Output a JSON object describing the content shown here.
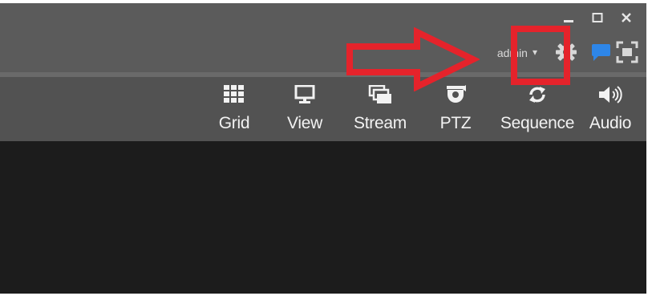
{
  "window": {
    "controls": [
      "minimize",
      "maximize",
      "close"
    ]
  },
  "user": {
    "name": "admin",
    "caret": "▾"
  },
  "header_icons": [
    "gear-icon",
    "chat-icon",
    "fullscreen-icon"
  ],
  "toolbar": {
    "items": [
      {
        "label": "Grid",
        "icon": "grid-icon"
      },
      {
        "label": "View",
        "icon": "monitor-icon"
      },
      {
        "label": "Stream",
        "icon": "stream-icon"
      },
      {
        "label": "PTZ",
        "icon": "ptz-camera-icon"
      },
      {
        "label": "Sequence",
        "icon": "sequence-icon"
      },
      {
        "label": "Audio",
        "icon": "speaker-icon"
      }
    ]
  },
  "colors": {
    "titlebar": "#5b5b5b",
    "toolbar": "#525252",
    "content": "#1c1c1c",
    "annotation": "#e5232b",
    "chat_accent": "#2e86e8",
    "icon": "#f2f2f2"
  }
}
